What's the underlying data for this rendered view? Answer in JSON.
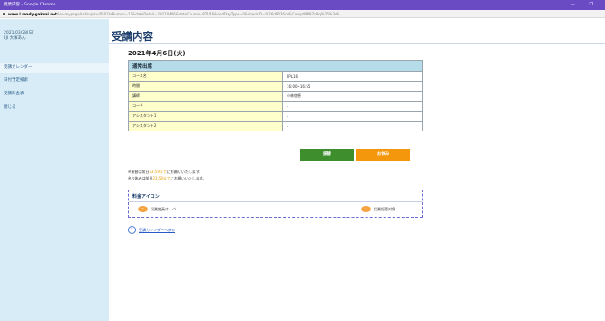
{
  "window": {
    "title": "授業内容 - Google Chrome",
    "controls": "— ❐"
  },
  "address": {
    "host": "www.l.ready-gakuai.net",
    "path": "/lec-mypage/l-shinjuku/0507/eBumon=11&dateDetail=20210406&dateCourse=8TU16&endDayType=0&checkID=%26d9026cd&ComptMP97cHq%26%3d&"
  },
  "sidebar": {
    "date": "2021/03/28(日)",
    "user": "FJI 大塚あん",
    "items": [
      {
        "label": "受講カレンダー"
      },
      {
        "label": "日付予定検索"
      },
      {
        "label": "受講料金表"
      },
      {
        "label": "閉じる"
      }
    ]
  },
  "page": {
    "title": "受講内容",
    "date_heading": "2021年4月6日(火)"
  },
  "details": {
    "header": "通常出席",
    "rows": [
      {
        "key": "コース名",
        "value": "FPL16"
      },
      {
        "key": "時間",
        "value": "16:00~16:55"
      },
      {
        "key": "講師",
        "value": "小林啓恵"
      },
      {
        "key": "コーチ",
        "value": "-"
      },
      {
        "key": "アシスタント1",
        "value": "-"
      },
      {
        "key": "アシスタント2",
        "value": "-"
      }
    ]
  },
  "actions": {
    "primary": "振替",
    "secondary": "お休み"
  },
  "notes": {
    "line1_pre": "※振替は前日",
    "line1_hl": "23:59まで",
    "line1_post": "にお願いいたします。",
    "line2_pre": "※お休みは前日",
    "line2_hl": "23:59まで",
    "line2_post": "にお願いいたします。"
  },
  "fees": {
    "title": "料金アイコン",
    "icon_text": "¥",
    "items": [
      {
        "label": "授業定員オーバー"
      },
      {
        "label": "授業振替対象"
      }
    ]
  },
  "back_link": "受講カレンダーへ戻る",
  "back_icon_glyph": "←"
}
